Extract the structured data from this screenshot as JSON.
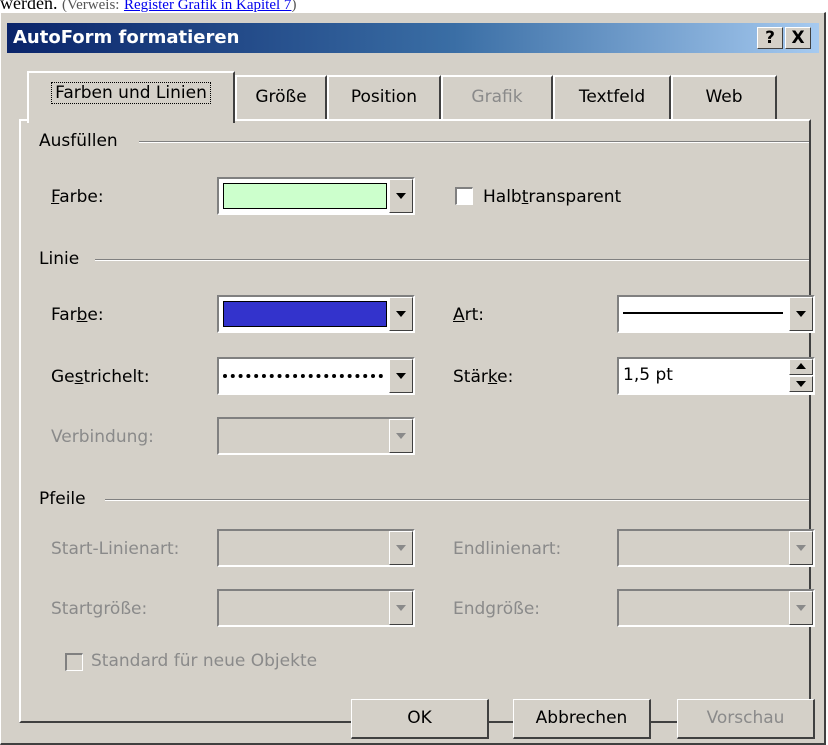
{
  "above": {
    "text": "werden.",
    "prefix": "(Verweis:",
    "link": "Register Grafik in Kapitel 7",
    "suffix": ")"
  },
  "dialog": {
    "title": "AutoForm formatieren",
    "help_btn": "?",
    "close_btn": "X"
  },
  "tabs": [
    {
      "label": "Farben und Linien",
      "active": true,
      "enabled": true
    },
    {
      "label": "Größe",
      "enabled": true
    },
    {
      "label": "Position",
      "enabled": true
    },
    {
      "label": "Grafik",
      "enabled": false
    },
    {
      "label": "Textfeld",
      "enabled": true
    },
    {
      "label": "Web",
      "enabled": true
    }
  ],
  "fill": {
    "group": "Ausfüllen",
    "color_label_pre": "",
    "color_label_key": "F",
    "color_label_post": "arbe:",
    "color": "#ccffcc",
    "semitransparent_pre": "Halb",
    "semitransparent_key": "t",
    "semitransparent_post": "ransparent",
    "semitransparent_checked": false
  },
  "line": {
    "group": "Linie",
    "color_label_pre": "Far",
    "color_label_key": "b",
    "color_label_post": "e:",
    "color": "#3333cc",
    "style_label_pre": "",
    "style_label_key": "A",
    "style_label_post": "rt:",
    "dashed_label_pre": "Ge",
    "dashed_label_key": "s",
    "dashed_label_post": "trichelt:",
    "weight_label_pre": "Stär",
    "weight_label_key": "k",
    "weight_label_post": "e:",
    "weight_value": "1,5 pt",
    "connector_label": "Verbindung:"
  },
  "arrows": {
    "group": "Pfeile",
    "begin_style": "Start-Linienart:",
    "end_style": "Endlinienart:",
    "begin_size": "Startgröße:",
    "end_size": "Endgröße:"
  },
  "default_checkbox": {
    "label": "Standard für neue Objekte",
    "checked": false
  },
  "buttons": {
    "ok": "OK",
    "cancel": "Abbrechen",
    "preview": "Vorschau"
  }
}
